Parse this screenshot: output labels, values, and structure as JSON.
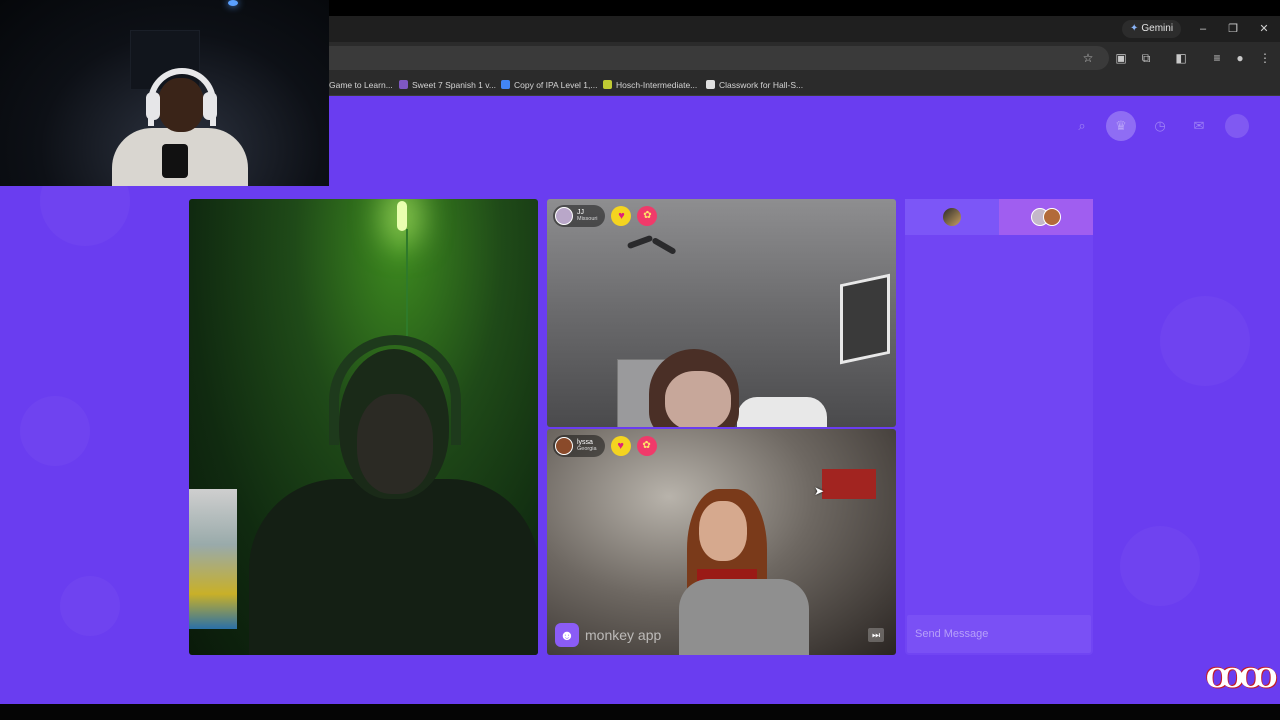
{
  "browser": {
    "gemini_label": "Gemini",
    "bookmarks": [
      {
        "label": "Game to Learn..."
      },
      {
        "label": "Sweet 7 Spanish 1 v..."
      },
      {
        "label": "Copy of IPA Level 1,..."
      },
      {
        "label": "Hosch-Intermediate..."
      },
      {
        "label": "Classwork for Hall-S..."
      }
    ]
  },
  "icons": {
    "search": "search-icon",
    "crown": "crown-icon",
    "history": "history-icon",
    "chat": "chat-icon",
    "profile": "profile-avatar"
  },
  "video": {
    "tile_tr": {
      "name": "JJ",
      "location": "Missouri"
    },
    "tile_br": {
      "name": "lyssa",
      "location": "Georgia"
    },
    "watermark": "monkey app"
  },
  "chat": {
    "placeholder": "Send Message"
  },
  "colors": {
    "page_bg": "#6a3df0",
    "chat_bg": "#7145f3",
    "heart_badge": "#f4d420",
    "gift_badge": "#f03a6a"
  }
}
